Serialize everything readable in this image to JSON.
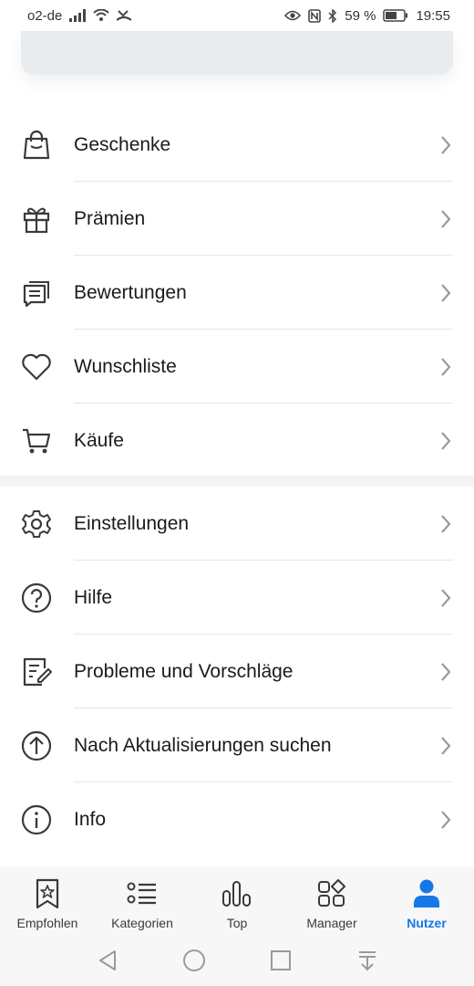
{
  "status_bar": {
    "carrier": "o2-de",
    "battery": "59 %",
    "time": "19:55"
  },
  "menu": {
    "group1": [
      {
        "label": "Geschenke",
        "icon": "shopping-bag-icon"
      },
      {
        "label": "Prämien",
        "icon": "gift-icon"
      },
      {
        "label": "Bewertungen",
        "icon": "comments-icon"
      },
      {
        "label": "Wunschliste",
        "icon": "heart-icon"
      },
      {
        "label": "Käufe",
        "icon": "cart-icon"
      }
    ],
    "group2": [
      {
        "label": "Einstellungen",
        "icon": "gear-icon"
      },
      {
        "label": "Hilfe",
        "icon": "help-icon"
      },
      {
        "label": "Probleme und Vorschläge",
        "icon": "feedback-icon"
      },
      {
        "label": "Nach Aktualisierungen suchen",
        "icon": "update-icon"
      },
      {
        "label": "Info",
        "icon": "info-icon"
      }
    ]
  },
  "bottom_nav": [
    {
      "label": "Empfohlen",
      "icon": "featured-icon"
    },
    {
      "label": "Kategorien",
      "icon": "categories-icon"
    },
    {
      "label": "Top",
      "icon": "top-chart-icon"
    },
    {
      "label": "Manager",
      "icon": "manager-icon"
    },
    {
      "label": "Nutzer",
      "icon": "user-icon",
      "active": true
    }
  ],
  "colors": {
    "accent": "#1479e6",
    "text": "#1a1a1a",
    "icon": "#3a3a3a",
    "chevron": "#9a9a9a"
  }
}
